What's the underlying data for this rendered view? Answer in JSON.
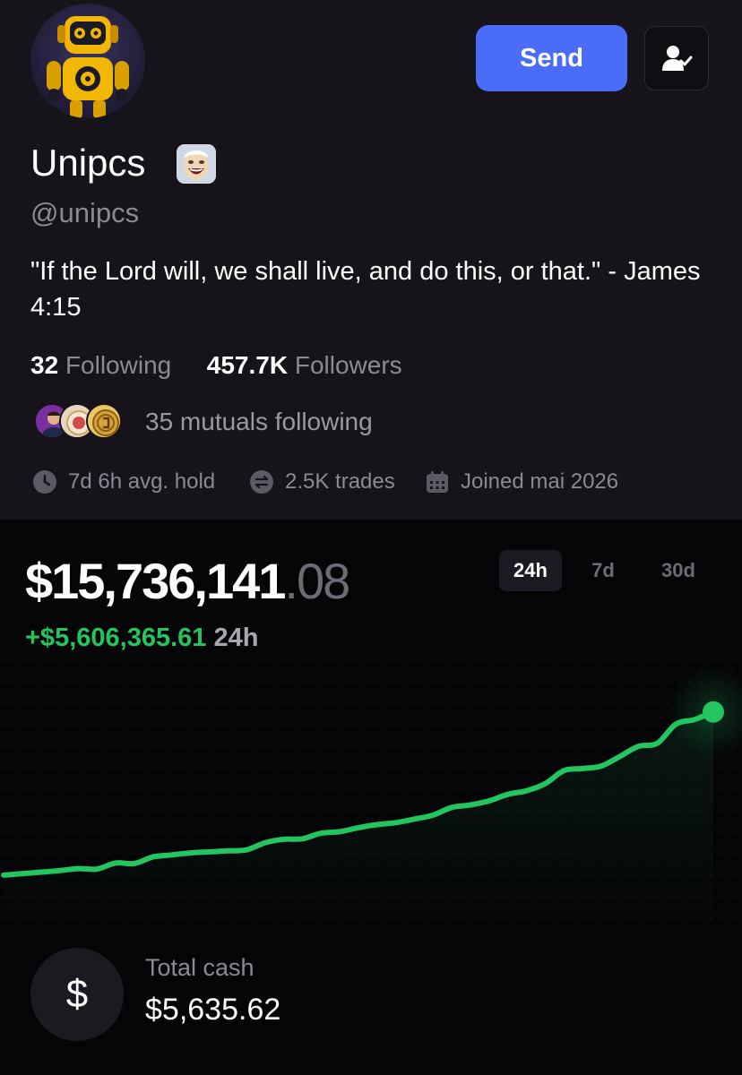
{
  "profile": {
    "display_name": "Unipcs",
    "handle": "@unipcs",
    "bio": "\"If the Lord will, we shall live, and do this, or that.\" - James 4:15",
    "avatar_icon": "robot-avatar",
    "name_badge_icon": "laughing-face-emoji"
  },
  "actions": {
    "send_label": "Send",
    "follow_icon": "user-check-icon"
  },
  "stats": {
    "following_count": "32",
    "following_label": "Following",
    "followers_count": "457.7K",
    "followers_label": "Followers"
  },
  "mutuals": {
    "text": "35 mutuals following"
  },
  "meta": {
    "avg_hold": "7d 6h avg. hold",
    "trades": "2.5K trades",
    "joined": "Joined mai 2026"
  },
  "portfolio": {
    "balance_whole": "$15,736,141",
    "balance_cents": ".08",
    "change_amount": "+$5,606,365.61",
    "change_period": "24h",
    "ranges": [
      {
        "label": "24h",
        "active": true
      },
      {
        "label": "7d",
        "active": false
      },
      {
        "label": "30d",
        "active": false
      }
    ]
  },
  "chart_data": {
    "type": "line",
    "title": "",
    "xlabel": "",
    "ylabel": "",
    "series": [
      {
        "values": [
          10.3,
          10.6,
          10.9,
          11.2,
          11.6,
          11.5,
          12.7,
          12.6,
          13.9,
          14.3,
          14.7,
          14.9,
          15.1,
          15.3,
          16.7,
          17.4,
          17.5,
          18.6,
          18.9,
          19.7,
          20.3,
          20.7,
          21.4,
          22.2,
          23.7,
          24.2,
          25.0,
          26.3,
          27.0,
          28.4,
          31.0,
          31.4,
          31.9,
          33.8,
          35.8,
          36.4,
          40.2,
          41.1,
          42.6
        ]
      }
    ],
    "ylim": [
      0,
      50
    ],
    "grid": false,
    "line_color": "#22c55e",
    "endpoint_color": "#22c55e"
  },
  "cash": {
    "label": "Total cash",
    "value": "$5,635.62",
    "icon": "dollar-icon",
    "icon_glyph": "$"
  },
  "colors": {
    "accent": "#4a6cf7",
    "positive": "#22c55e",
    "header_bg": "#16141a",
    "body_bg": "#050508"
  }
}
